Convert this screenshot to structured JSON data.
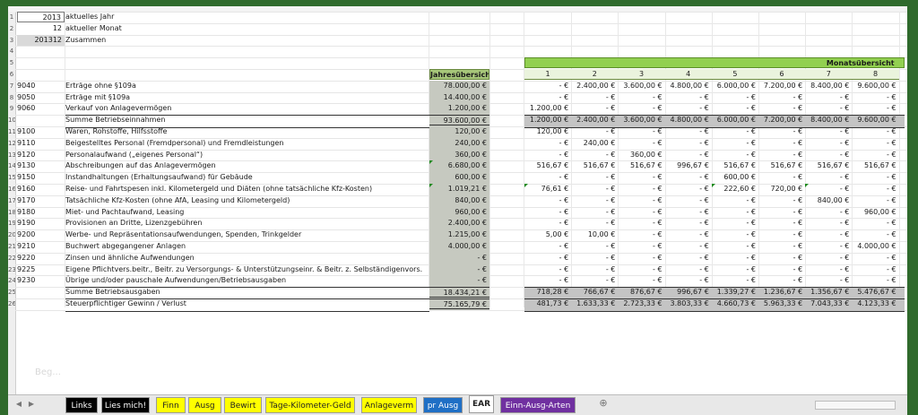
{
  "top_block": [
    {
      "row": "1",
      "value": "2013",
      "label": "aktuelles Jahr"
    },
    {
      "row": "2",
      "value": "12",
      "label": "aktueller Monat"
    },
    {
      "row": "3",
      "value": "201312",
      "label": "Zusammen"
    }
  ],
  "yearly_header": "Jahresübersicht",
  "monthly_header": "Monatsübersicht",
  "month_numbers": [
    "1",
    "2",
    "3",
    "4",
    "5",
    "6",
    "7",
    "8"
  ],
  "faded_logo": "Beg...",
  "rows": [
    {
      "rowhdr": "7",
      "code": "9040",
      "label": "Erträge ohne §109a",
      "year": "78.000,00 €",
      "months": [
        "- €",
        "2.400,00 €",
        "3.600,00 €",
        "4.800,00 €",
        "6.000,00 €",
        "7.200,00 €",
        "8.400,00 €",
        "9.600,00 €"
      ]
    },
    {
      "rowhdr": "8",
      "code": "9050",
      "label": "Erträge mit §109a",
      "year": "14.400,00 €",
      "months": [
        "- €",
        "- €",
        "- €",
        "- €",
        "- €",
        "- €",
        "- €",
        "- €"
      ]
    },
    {
      "rowhdr": "9",
      "code": "9060",
      "label": "Verkauf von Anlagevermögen",
      "year": "1.200,00 €",
      "months": [
        "1.200,00 €",
        "- €",
        "- €",
        "- €",
        "- €",
        "- €",
        "- €",
        "- €"
      ]
    },
    {
      "rowhdr": "10",
      "code": "",
      "label": "Summe Betriebseinnahmen",
      "year": "93.600,00 €",
      "months": [
        "1.200,00 €",
        "2.400,00 €",
        "3.600,00 €",
        "4.800,00 €",
        "6.000,00 €",
        "7.200,00 €",
        "8.400,00 €",
        "9.600,00 €"
      ],
      "sum": true
    },
    {
      "rowhdr": "11",
      "code": "9100",
      "label": "Waren, Rohstoffe, Hilfsstoffe",
      "year": "120,00 €",
      "months": [
        "120,00 €",
        "- €",
        "- €",
        "- €",
        "- €",
        "- €",
        "- €",
        "- €"
      ]
    },
    {
      "rowhdr": "12",
      "code": "9110",
      "label": "Beigestelltes Personal (Fremdpersonal) und Fremdleistungen",
      "year": "240,00 €",
      "months": [
        "- €",
        "240,00 €",
        "- €",
        "- €",
        "- €",
        "- €",
        "- €",
        "- €"
      ]
    },
    {
      "rowhdr": "13",
      "code": "9120",
      "label": "Personalaufwand („eigenes Personal“)",
      "year": "360,00 €",
      "months": [
        "- €",
        "- €",
        "360,00 €",
        "- €",
        "- €",
        "- €",
        "- €",
        "- €"
      ]
    },
    {
      "rowhdr": "14",
      "code": "9130",
      "label": "Abschreibungen auf das Anlagevermögen",
      "year": "6.680,00 €",
      "months": [
        "516,67 €",
        "516,67 €",
        "516,67 €",
        "996,67 €",
        "516,67 €",
        "516,67 €",
        "516,67 €",
        "516,67 €"
      ]
    },
    {
      "rowhdr": "15",
      "code": "9150",
      "label": "Instandhaltungen (Erhaltungsaufwand) für Gebäude",
      "year": "600,00 €",
      "months": [
        "- €",
        "- €",
        "- €",
        "- €",
        "600,00 €",
        "- €",
        "- €",
        "- €"
      ]
    },
    {
      "rowhdr": "16",
      "code": "9160",
      "label": "Reise- und Fahrtspesen inkl. Kilometergeld und Diäten (ohne tatsächliche Kfz-Kosten)",
      "year": "1.019,21 €",
      "months": [
        "76,61 €",
        "- €",
        "- €",
        "- €",
        "222,60 €",
        "720,00 €",
        "- €",
        "- €"
      ]
    },
    {
      "rowhdr": "17",
      "code": "9170",
      "label": "Tatsächliche Kfz-Kosten (ohne AfA, Leasing und Kilometergeld)",
      "year": "840,00 €",
      "months": [
        "- €",
        "- €",
        "- €",
        "- €",
        "- €",
        "- €",
        "840,00 €",
        "- €"
      ]
    },
    {
      "rowhdr": "18",
      "code": "9180",
      "label": "Miet- und Pachtaufwand, Leasing",
      "year": "960,00 €",
      "months": [
        "- €",
        "- €",
        "- €",
        "- €",
        "- €",
        "- €",
        "- €",
        "960,00 €"
      ]
    },
    {
      "rowhdr": "19",
      "code": "9190",
      "label": "Provisionen an Dritte, Lizenzgebühren",
      "year": "2.400,00 €",
      "months": [
        "- €",
        "- €",
        "- €",
        "- €",
        "- €",
        "- €",
        "- €",
        "- €"
      ]
    },
    {
      "rowhdr": "20",
      "code": "9200",
      "label": "Werbe- und Repräsentationsaufwendungen, Spenden, Trinkgelder",
      "year": "1.215,00 €",
      "months": [
        "5,00 €",
        "10,00 €",
        "- €",
        "- €",
        "- €",
        "- €",
        "- €",
        "- €"
      ]
    },
    {
      "rowhdr": "21",
      "code": "9210",
      "label": "Buchwert abgegangener Anlagen",
      "year": "4.000,00 €",
      "months": [
        "- €",
        "- €",
        "- €",
        "- €",
        "- €",
        "- €",
        "- €",
        "4.000,00 €"
      ]
    },
    {
      "rowhdr": "22",
      "code": "9220",
      "label": "Zinsen und ähnliche Aufwendungen",
      "year": "- €",
      "months": [
        "- €",
        "- €",
        "- €",
        "- €",
        "- €",
        "- €",
        "- €",
        "- €"
      ]
    },
    {
      "rowhdr": "23",
      "code": "9225",
      "label": "Eigene Pflichtvers.beitr., Beitr. zu Versorgungs- & Unterstützungseinr. & Beitr. z. Selbständigenvors.",
      "year": "- €",
      "months": [
        "- €",
        "- €",
        "- €",
        "- €",
        "- €",
        "- €",
        "- €",
        "- €"
      ]
    },
    {
      "rowhdr": "24",
      "code": "9230",
      "label": "Übrige und/oder pauschale Aufwendungen/Betriebsausgaben",
      "year": "- €",
      "months": [
        "- €",
        "- €",
        "- €",
        "- €",
        "- €",
        "- €",
        "- €",
        "- €"
      ]
    },
    {
      "rowhdr": "25",
      "code": "",
      "label": "Summe Betriebsausgaben",
      "year": "18.434,21 €",
      "months": [
        "718,28 €",
        "766,67 €",
        "876,67 €",
        "996,67 €",
        "1.339,27 €",
        "1.236,67 €",
        "1.356,67 €",
        "5.476,67 €"
      ],
      "sum": true
    },
    {
      "rowhdr": "26",
      "code": "",
      "label": "Steuerpflichtiger Gewinn / Verlust",
      "year": "75.165,79 €",
      "months": [
        "481,73 €",
        "1.633,33 €",
        "2.723,33 €",
        "3.803,33 €",
        "4.660,73 €",
        "5.963,33 €",
        "7.043,33 €",
        "4.123,33 €"
      ],
      "sum": true
    }
  ],
  "tabs": [
    {
      "label": "Links",
      "bg": "#000000",
      "fg": "#ffffff"
    },
    {
      "label": "Lies mich!",
      "bg": "#000000",
      "fg": "#ffffff"
    },
    {
      "label": "Finn",
      "bg": "#ffff00",
      "fg": "#202020"
    },
    {
      "label": "Ausg",
      "bg": "#ffff00",
      "fg": "#202020"
    },
    {
      "label": "Bewirt",
      "bg": "#ffff00",
      "fg": "#202020"
    },
    {
      "label": "Tage-Kilometer-Geld",
      "bg": "#ffff00",
      "fg": "#202020"
    },
    {
      "label": "Anlageverm",
      "bg": "#ffff00",
      "fg": "#202020"
    },
    {
      "label": "pr Ausg",
      "bg": "#1f6fc5",
      "fg": "#ffffff"
    },
    {
      "label": "EAR",
      "bg": "#ffffff",
      "fg": "#202020",
      "active": true
    },
    {
      "label": "Einn-Ausg-Arten",
      "bg": "#7030a0",
      "fg": "#ffffff"
    }
  ],
  "add_sheet": "⊕"
}
